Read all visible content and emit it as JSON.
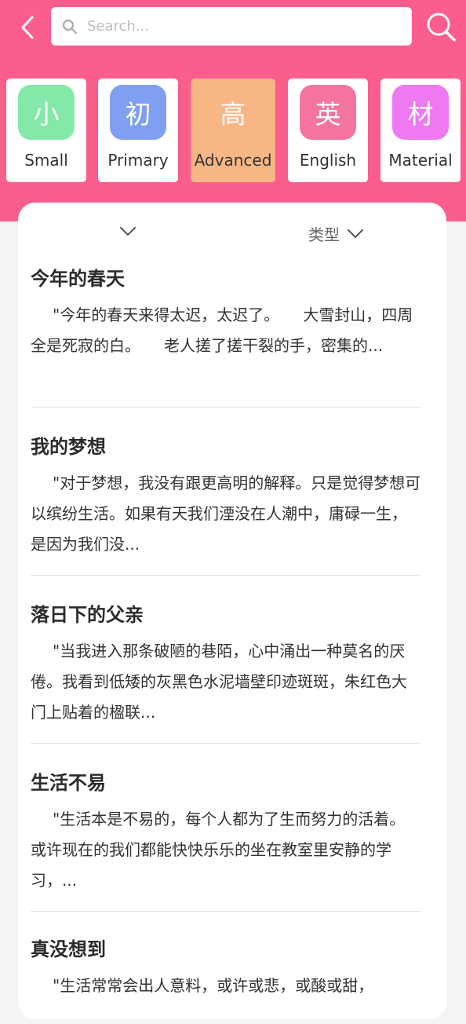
{
  "colors": {
    "header_bg": "#fb5d8d",
    "small": "#84e8a9",
    "primary": "#7f9ff2",
    "advanced": "#f8b685",
    "english": "#f5739f",
    "material": "#ee79f0"
  },
  "search": {
    "placeholder": "Search..."
  },
  "categories": [
    {
      "glyph": "小",
      "label": "Small",
      "active": false
    },
    {
      "glyph": "初",
      "label": "Primary",
      "active": false
    },
    {
      "glyph": "高",
      "label": "Advanced",
      "active": true
    },
    {
      "glyph": "英",
      "label": "English",
      "active": false
    },
    {
      "glyph": "材",
      "label": "Material",
      "active": false
    }
  ],
  "filters": {
    "type_label": "类型"
  },
  "articles": [
    {
      "title": "今年的春天",
      "excerpt": "\"今年的春天来得太迟，太迟了。　　大雪封山，四周全是死寂的白。　　老人搓了搓干裂的手，密集的..."
    },
    {
      "title": "我的梦想",
      "excerpt": "\"对于梦想，我没有跟更高明的解释。只是觉得梦想可以缤纷生活。如果有天我们湮没在人潮中，庸碌一生，是因为我们没..."
    },
    {
      "title": "落日下的父亲",
      "excerpt": "\"当我进入那条破陋的巷陌，心中涌出一种莫名的厌倦。我看到低矮的灰黑色水泥墙壁印迹斑斑，朱红色大门上贴着的楹联..."
    },
    {
      "title": "生活不易",
      "excerpt": "\"生活本是不易的，每个人都为了生而努力的活着。　　或许现在的我们都能快快乐乐的坐在教室里安静的学习，..."
    },
    {
      "title": "真没想到",
      "excerpt": "\"生活常常会出人意料，或许或悲，或酸或甜，"
    }
  ]
}
